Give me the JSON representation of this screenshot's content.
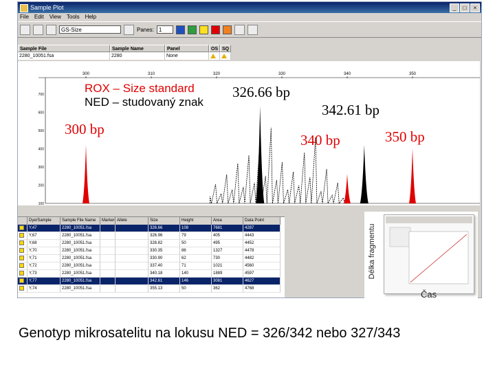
{
  "window": {
    "title": "Sample Plot",
    "controls": [
      "_",
      "□",
      "×"
    ]
  },
  "menu": {
    "items": [
      "File",
      "Edit",
      "View",
      "Tools",
      "Help"
    ]
  },
  "toolbar": {
    "dye_select": "GS-Size",
    "panes_label": "Panes:",
    "panes_value": "1"
  },
  "sample_table": {
    "columns": [
      "Sample File",
      "Sample Name",
      "Panel",
      "OS",
      "SQ"
    ],
    "row": {
      "file": "2280_10051.fsa",
      "name": "2280",
      "panel": "None"
    }
  },
  "plot": {
    "x_ticks": [
      "300",
      "310",
      "320",
      "330",
      "340",
      "350"
    ],
    "y_ticks": [
      "700",
      "600",
      "500",
      "400",
      "300",
      "200",
      "100"
    ],
    "colors": {
      "rox": "#e00000",
      "ned": "#000000"
    }
  },
  "overlay": {
    "legend_rox": "ROX – Size standard",
    "legend_ned": "NED – studovaný znak",
    "label_326": "326.66 bp",
    "label_342": "342.61 bp",
    "label_300": "300 bp",
    "label_340": "340 bp",
    "label_350": "350 bp"
  },
  "grid": {
    "columns": [
      "",
      "Dye/Sample Peak",
      "Sample File Name",
      "Marker",
      "Allele",
      "Size",
      "Height",
      "Area",
      "Data Point"
    ],
    "rows": [
      {
        "peak": "Y,47",
        "file": "2280_10051.fsa",
        "size": "326.66",
        "height": "108",
        "area": "7681",
        "point": "4287",
        "selected": true
      },
      {
        "peak": "Y,67",
        "file": "2280_10051.fsa",
        "size": "326.96",
        "height": "79",
        "area": "405",
        "point": "4443",
        "selected": false
      },
      {
        "peak": "Y,68",
        "file": "2280_10051.fsa",
        "size": "328.82",
        "height": "50",
        "area": "495",
        "point": "4452",
        "selected": false
      },
      {
        "peak": "Y,70",
        "file": "2280_10051.fsa",
        "size": "330.35",
        "height": "86",
        "area": "1327",
        "point": "4478",
        "selected": false
      },
      {
        "peak": "Y,71",
        "file": "2280_10051.fsa",
        "size": "330.90",
        "height": "62",
        "area": "730",
        "point": "4482",
        "selected": false
      },
      {
        "peak": "Y,72",
        "file": "2280_10051.fsa",
        "size": "337.40",
        "height": "71",
        "area": "1021",
        "point": "4560",
        "selected": false
      },
      {
        "peak": "Y,73",
        "file": "2280_10051.fsa",
        "size": "340.18",
        "height": "140",
        "area": "1889",
        "point": "4597",
        "selected": false
      },
      {
        "peak": "Y,77",
        "file": "2280_10051.fsa",
        "size": "342.61",
        "height": "146",
        "area": "3081",
        "point": "4627",
        "selected": true
      },
      {
        "peak": "Y,74",
        "file": "2280_10051.fsa",
        "size": "355.13",
        "height": "50",
        "area": "362",
        "point": "4768",
        "selected": false
      }
    ]
  },
  "inset": {
    "ylabel": "Délka fragmentu",
    "xlabel": "Čas"
  },
  "caption": "Genotyp mikrosatelitu na lokusu NED = 326/342 nebo 327/343"
}
